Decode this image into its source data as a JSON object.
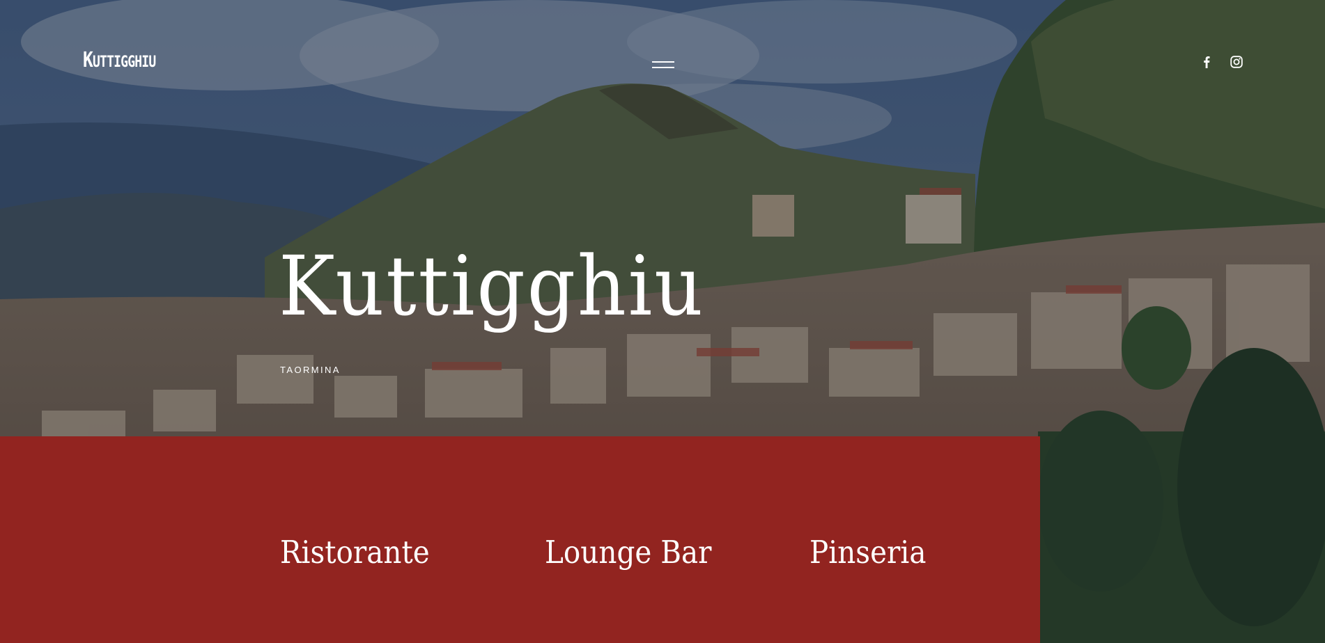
{
  "header": {
    "logo_text_first": "K",
    "logo_text_rest": "UTTIGGHIU",
    "menu_icon": "hamburger-menu-icon",
    "social": [
      {
        "icon": "facebook-icon"
      },
      {
        "icon": "instagram-icon"
      }
    ]
  },
  "hero": {
    "title": "Kuttigghiu",
    "subtitle": "TAORMINA"
  },
  "sections": {
    "links": [
      {
        "label": "Ristorante"
      },
      {
        "label": "Lounge Bar"
      },
      {
        "label": "Pinseria"
      }
    ]
  },
  "colors": {
    "accent_red": "#922420",
    "text": "#ffffff"
  }
}
